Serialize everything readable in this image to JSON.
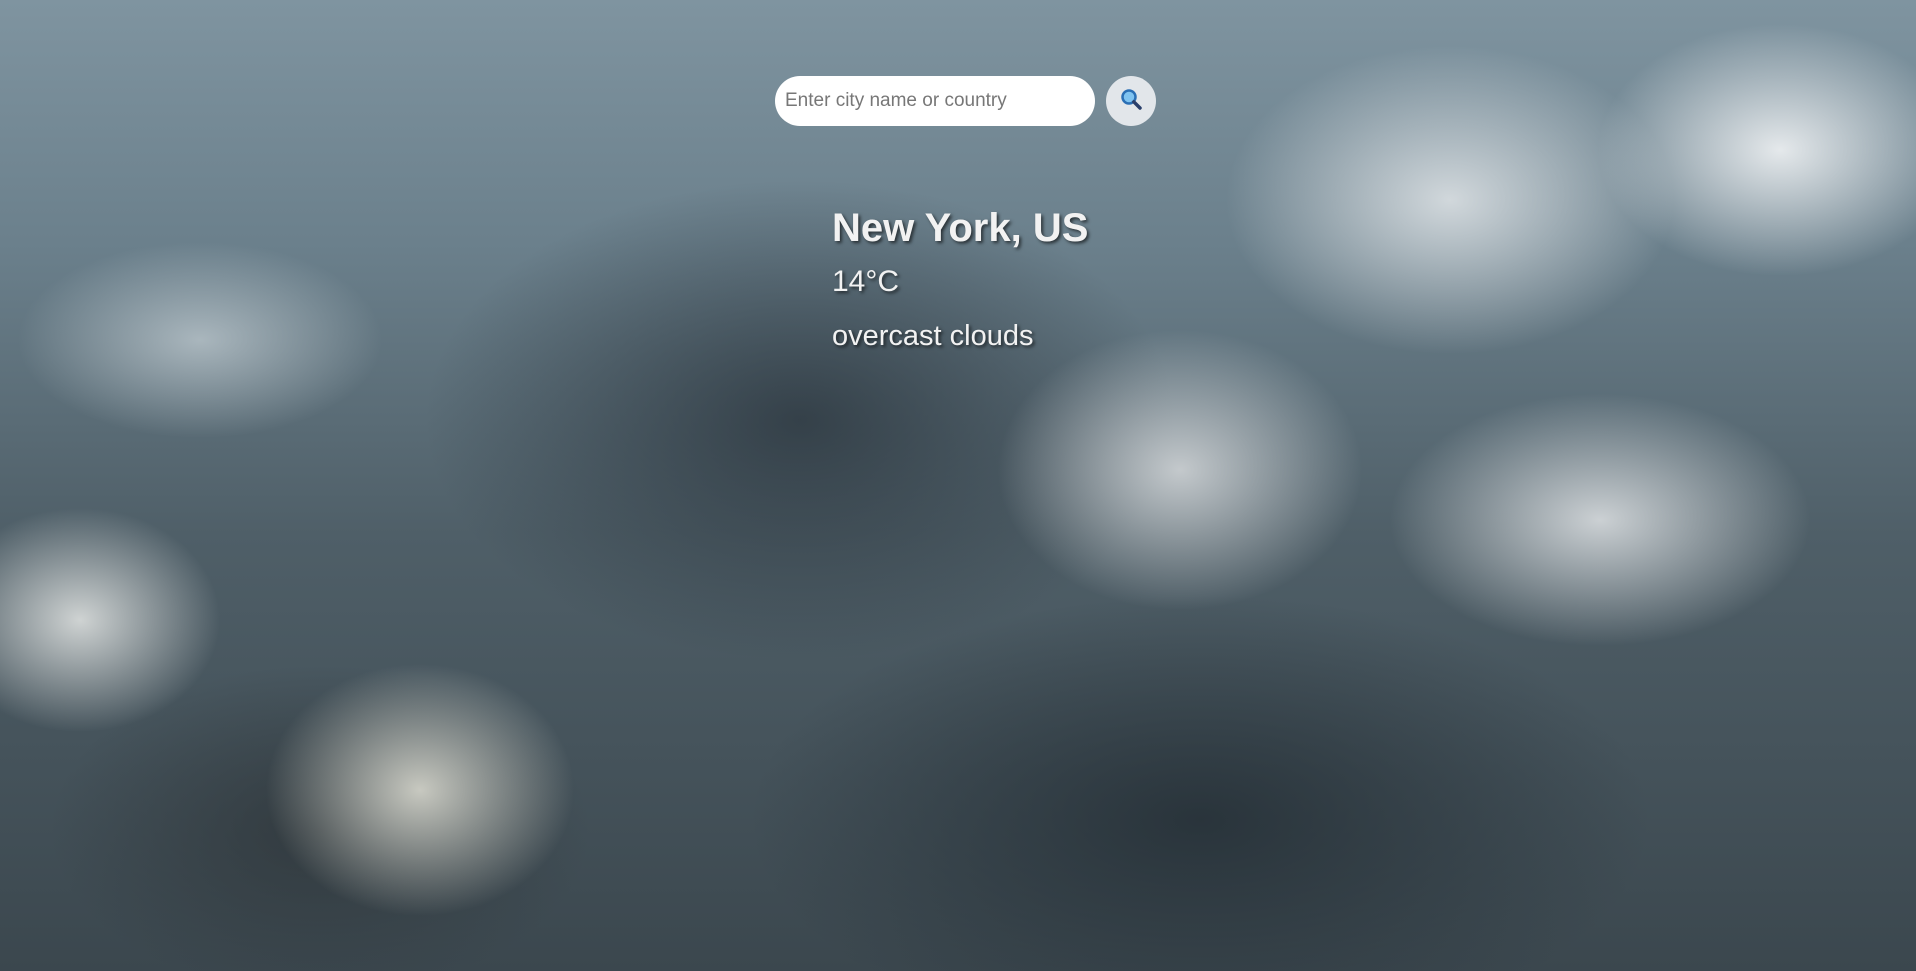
{
  "search": {
    "placeholder": "Enter city name or country",
    "value": "",
    "button_icon": "magnifying-glass-icon"
  },
  "weather": {
    "location": "New York, US",
    "temperature": "14°C",
    "description": "overcast clouds"
  },
  "background": {
    "image": "cloudy-sky"
  }
}
